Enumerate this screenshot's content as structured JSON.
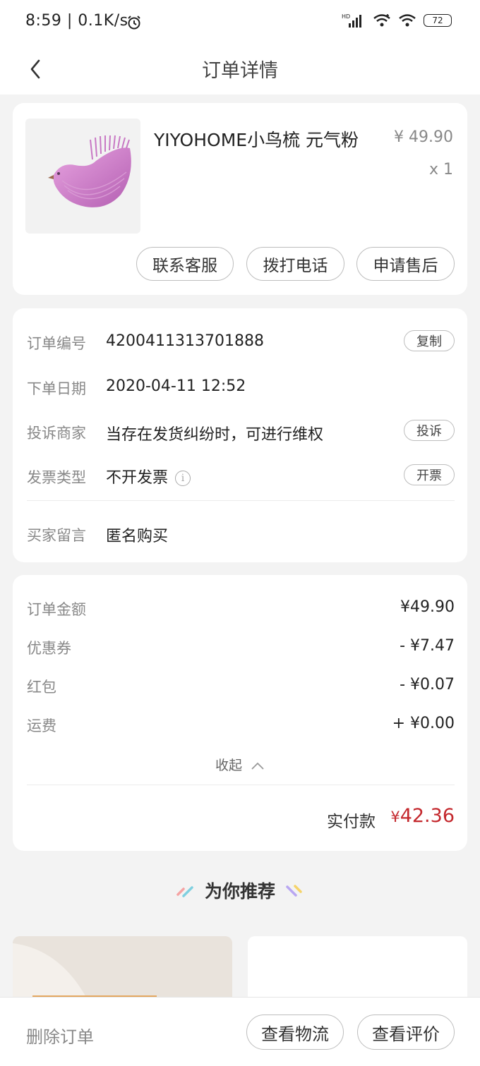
{
  "status_bar": {
    "time": "8:59 | 0.1K/s",
    "battery": "72",
    "network_label": "HD"
  },
  "nav": {
    "title": "订单详情"
  },
  "product": {
    "name": "YIYOHOME小鸟梳 元气粉",
    "price": "¥ 49.90",
    "qty": "x 1",
    "actions": {
      "contact_service": "联系客服",
      "call": "拨打电话",
      "after_sales": "申请售后"
    }
  },
  "order_info": {
    "order_no_label": "订单编号",
    "order_no": "4200411313701888",
    "copy": "复制",
    "date_label": "下单日期",
    "date": "2020-04-11 12:52",
    "complain_label": "投诉商家",
    "complain_desc": "当存在发货纠纷时，可进行维权",
    "complain_btn": "投诉",
    "invoice_label": "发票类型",
    "invoice_value": "不开发票",
    "invoice_btn": "开票",
    "message_label": "买家留言",
    "message_value": "匿名购买"
  },
  "amounts": {
    "order_amount_label": "订单金额",
    "order_amount": "¥49.90",
    "coupon_label": "优惠券",
    "coupon": "- ¥7.47",
    "redpacket_label": "红包",
    "redpacket": "- ¥0.07",
    "shipping_label": "运费",
    "shipping": "+ ¥0.00",
    "collapse": "收起",
    "paid_label": "实付款",
    "paid_currency": "¥",
    "paid_amount": "42.36"
  },
  "recommend": {
    "title": "为你推荐"
  },
  "bottom": {
    "delete": "删除订单",
    "logistics": "查看物流",
    "review": "查看评价"
  },
  "colors": {
    "accent_price": "#c4282d",
    "background": "#f3f3f3"
  }
}
